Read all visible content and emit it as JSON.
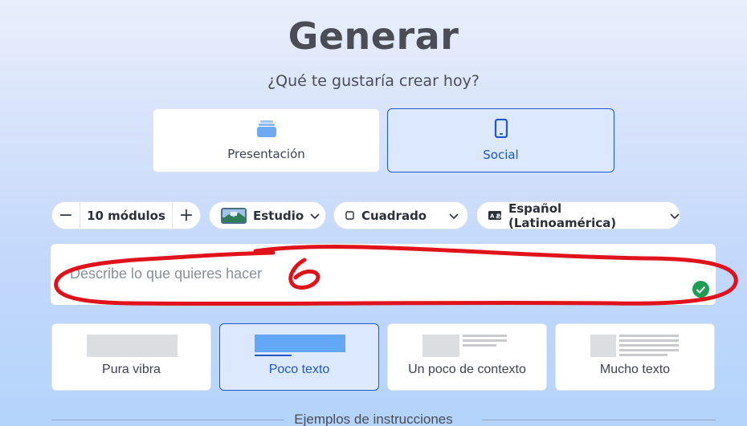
{
  "header": {
    "title": "Generar",
    "subtitle": "¿Qué te gustaría crear hoy?"
  },
  "modes": [
    {
      "label": "Presentación",
      "icon": "stack-icon",
      "selected": false
    },
    {
      "label": "Social",
      "icon": "phone-icon",
      "selected": true
    }
  ],
  "options": {
    "stepper": {
      "minus": "−",
      "plus": "+",
      "value": "10 módulos"
    },
    "theme": {
      "label": "Estudio",
      "icon": "theme-thumbnail-icon"
    },
    "format": {
      "label": "Cuadrado",
      "icon": "square-icon"
    },
    "language": {
      "label": "Español (Latinoamérica)",
      "icon": "translate-icon"
    }
  },
  "prompt": {
    "placeholder": "Describe lo que quieres hacer",
    "status_icon": "check-circle-icon"
  },
  "text_amounts": [
    {
      "label": "Pura vibra",
      "selected": false
    },
    {
      "label": "Poco texto",
      "selected": true
    },
    {
      "label": "Un poco de contexto",
      "selected": false
    },
    {
      "label": "Mucho texto",
      "selected": false
    }
  ],
  "footer": {
    "label": "Ejemplos de instrucciones"
  },
  "colors": {
    "accent": "#1f56c9",
    "annotation": "#e0121b",
    "success": "#1f9d55"
  }
}
